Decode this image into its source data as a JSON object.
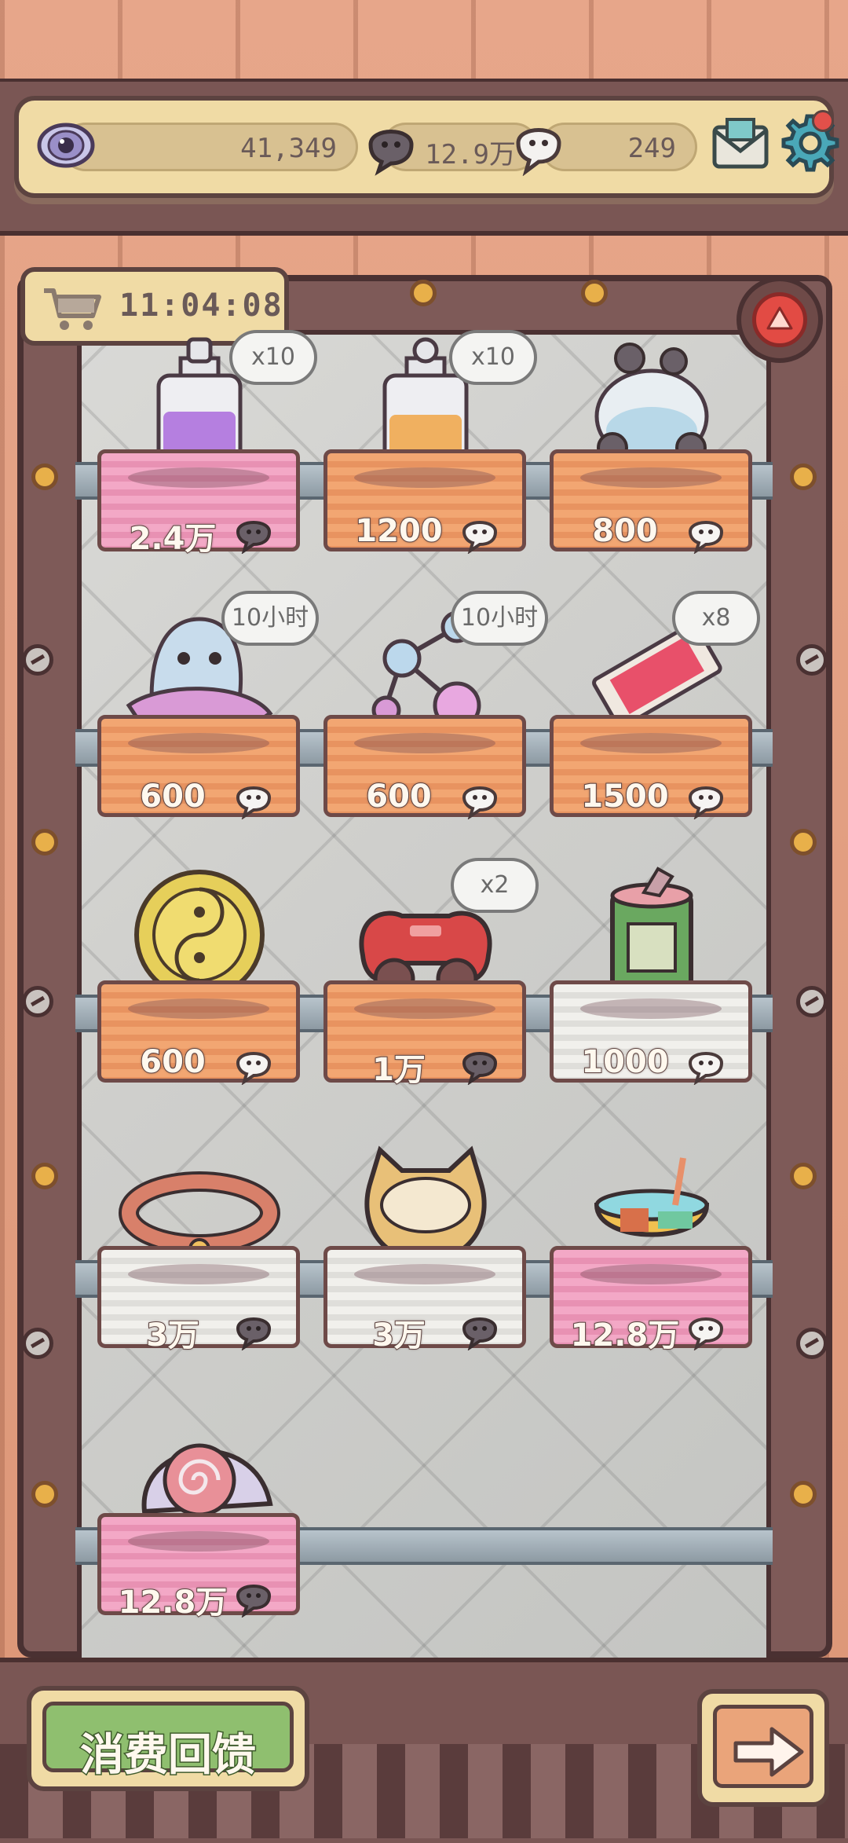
{
  "resources": {
    "eye_value": "41,349",
    "dark_spirit_value": "12.9万",
    "light_spirit_value": "249"
  },
  "timer": {
    "text": "11:04:08"
  },
  "items": [
    {
      "name": "purple-potion",
      "price": "2.4万",
      "currency": "dark",
      "badge": "x10",
      "cloth": "pink"
    },
    {
      "name": "orange-potion",
      "price": "1200",
      "currency": "light",
      "badge": "x10",
      "cloth": "orange"
    },
    {
      "name": "spirit-fishbowl",
      "price": "800",
      "currency": "light",
      "badge": "",
      "cloth": "orange"
    },
    {
      "name": "ghost-blanket",
      "price": "600",
      "currency": "light",
      "badge": "10小时",
      "cloth": "orange"
    },
    {
      "name": "molecule-flask",
      "price": "600",
      "currency": "light",
      "badge": "10小时",
      "cloth": "orange"
    },
    {
      "name": "ticket",
      "price": "1500",
      "currency": "light",
      "badge": "x8",
      "cloth": "orange"
    },
    {
      "name": "yin-yang-coin",
      "price": "600",
      "currency": "light",
      "badge": "",
      "cloth": "orange"
    },
    {
      "name": "game-controller",
      "price": "1万",
      "currency": "dark",
      "badge": "x2",
      "cloth": "orange"
    },
    {
      "name": "food-can",
      "price": "1000",
      "currency": "light",
      "badge": "",
      "cloth": "white"
    },
    {
      "name": "pet-collar",
      "price": "3万",
      "currency": "dark",
      "badge": "",
      "cloth": "white"
    },
    {
      "name": "cat-bowl",
      "price": "3万",
      "currency": "dark",
      "badge": "",
      "cloth": "white"
    },
    {
      "name": "drink-bowl",
      "price": "12.8万",
      "currency": "light",
      "badge": "",
      "cloth": "pink"
    },
    {
      "name": "snail-shell",
      "price": "12.8万",
      "currency": "dark",
      "badge": "",
      "cloth": "pink"
    }
  ],
  "buttons": {
    "feedback_label": "消费回馈"
  },
  "colors": {
    "panel": "#f0dba5",
    "frame": "#5c4340",
    "cloth_orange": "#f2a672",
    "cloth_pink": "#f3a8c6",
    "cloth_white": "#f1f0ec",
    "feedback_green": "#8fbf6f",
    "alert_red": "#e24b44"
  }
}
